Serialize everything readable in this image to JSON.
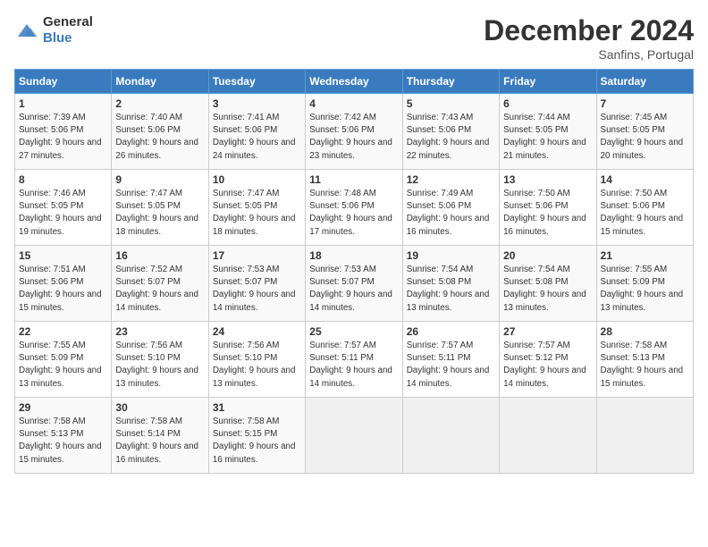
{
  "logo": {
    "text_general": "General",
    "text_blue": "Blue"
  },
  "title": "December 2024",
  "subtitle": "Sanfins, Portugal",
  "weekdays": [
    "Sunday",
    "Monday",
    "Tuesday",
    "Wednesday",
    "Thursday",
    "Friday",
    "Saturday"
  ],
  "weeks": [
    [
      {
        "day": 1,
        "sunrise": "7:39 AM",
        "sunset": "5:06 PM",
        "daylight": "9 hours and 27 minutes."
      },
      {
        "day": 2,
        "sunrise": "7:40 AM",
        "sunset": "5:06 PM",
        "daylight": "9 hours and 26 minutes."
      },
      {
        "day": 3,
        "sunrise": "7:41 AM",
        "sunset": "5:06 PM",
        "daylight": "9 hours and 24 minutes."
      },
      {
        "day": 4,
        "sunrise": "7:42 AM",
        "sunset": "5:06 PM",
        "daylight": "9 hours and 23 minutes."
      },
      {
        "day": 5,
        "sunrise": "7:43 AM",
        "sunset": "5:06 PM",
        "daylight": "9 hours and 22 minutes."
      },
      {
        "day": 6,
        "sunrise": "7:44 AM",
        "sunset": "5:05 PM",
        "daylight": "9 hours and 21 minutes."
      },
      {
        "day": 7,
        "sunrise": "7:45 AM",
        "sunset": "5:05 PM",
        "daylight": "9 hours and 20 minutes."
      }
    ],
    [
      {
        "day": 8,
        "sunrise": "7:46 AM",
        "sunset": "5:05 PM",
        "daylight": "9 hours and 19 minutes."
      },
      {
        "day": 9,
        "sunrise": "7:47 AM",
        "sunset": "5:05 PM",
        "daylight": "9 hours and 18 minutes."
      },
      {
        "day": 10,
        "sunrise": "7:47 AM",
        "sunset": "5:05 PM",
        "daylight": "9 hours and 18 minutes."
      },
      {
        "day": 11,
        "sunrise": "7:48 AM",
        "sunset": "5:06 PM",
        "daylight": "9 hours and 17 minutes."
      },
      {
        "day": 12,
        "sunrise": "7:49 AM",
        "sunset": "5:06 PM",
        "daylight": "9 hours and 16 minutes."
      },
      {
        "day": 13,
        "sunrise": "7:50 AM",
        "sunset": "5:06 PM",
        "daylight": "9 hours and 16 minutes."
      },
      {
        "day": 14,
        "sunrise": "7:50 AM",
        "sunset": "5:06 PM",
        "daylight": "9 hours and 15 minutes."
      }
    ],
    [
      {
        "day": 15,
        "sunrise": "7:51 AM",
        "sunset": "5:06 PM",
        "daylight": "9 hours and 15 minutes."
      },
      {
        "day": 16,
        "sunrise": "7:52 AM",
        "sunset": "5:07 PM",
        "daylight": "9 hours and 14 minutes."
      },
      {
        "day": 17,
        "sunrise": "7:53 AM",
        "sunset": "5:07 PM",
        "daylight": "9 hours and 14 minutes."
      },
      {
        "day": 18,
        "sunrise": "7:53 AM",
        "sunset": "5:07 PM",
        "daylight": "9 hours and 14 minutes."
      },
      {
        "day": 19,
        "sunrise": "7:54 AM",
        "sunset": "5:08 PM",
        "daylight": "9 hours and 13 minutes."
      },
      {
        "day": 20,
        "sunrise": "7:54 AM",
        "sunset": "5:08 PM",
        "daylight": "9 hours and 13 minutes."
      },
      {
        "day": 21,
        "sunrise": "7:55 AM",
        "sunset": "5:09 PM",
        "daylight": "9 hours and 13 minutes."
      }
    ],
    [
      {
        "day": 22,
        "sunrise": "7:55 AM",
        "sunset": "5:09 PM",
        "daylight": "9 hours and 13 minutes."
      },
      {
        "day": 23,
        "sunrise": "7:56 AM",
        "sunset": "5:10 PM",
        "daylight": "9 hours and 13 minutes."
      },
      {
        "day": 24,
        "sunrise": "7:56 AM",
        "sunset": "5:10 PM",
        "daylight": "9 hours and 13 minutes."
      },
      {
        "day": 25,
        "sunrise": "7:57 AM",
        "sunset": "5:11 PM",
        "daylight": "9 hours and 14 minutes."
      },
      {
        "day": 26,
        "sunrise": "7:57 AM",
        "sunset": "5:11 PM",
        "daylight": "9 hours and 14 minutes."
      },
      {
        "day": 27,
        "sunrise": "7:57 AM",
        "sunset": "5:12 PM",
        "daylight": "9 hours and 14 minutes."
      },
      {
        "day": 28,
        "sunrise": "7:58 AM",
        "sunset": "5:13 PM",
        "daylight": "9 hours and 15 minutes."
      }
    ],
    [
      {
        "day": 29,
        "sunrise": "7:58 AM",
        "sunset": "5:13 PM",
        "daylight": "9 hours and 15 minutes."
      },
      {
        "day": 30,
        "sunrise": "7:58 AM",
        "sunset": "5:14 PM",
        "daylight": "9 hours and 16 minutes."
      },
      {
        "day": 31,
        "sunrise": "7:58 AM",
        "sunset": "5:15 PM",
        "daylight": "9 hours and 16 minutes."
      },
      null,
      null,
      null,
      null
    ]
  ],
  "labels": {
    "sunrise": "Sunrise:",
    "sunset": "Sunset:",
    "daylight": "Daylight:"
  }
}
